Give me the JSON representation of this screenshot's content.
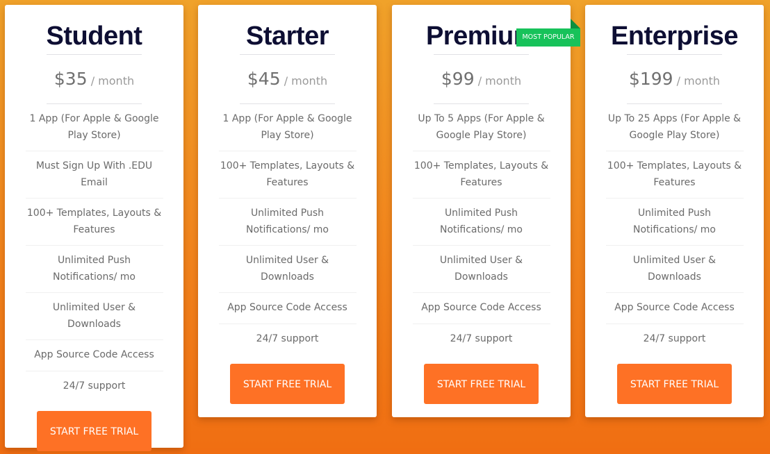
{
  "plans": [
    {
      "name": "Student",
      "price": "$35",
      "period": "/ month",
      "features": [
        "1 App (For Apple & Google Play Store)",
        "Must Sign Up With .EDU Email",
        "100+ Templates, Layouts & Features",
        "Unlimited Push Notifications/ mo",
        "Unlimited User & Downloads",
        "App Source Code Access",
        "24/7 support"
      ],
      "cta": "START FREE TRIAL"
    },
    {
      "name": "Starter",
      "price": "$45",
      "period": "/ month",
      "features": [
        "1 App (For Apple & Google Play Store)",
        "100+ Templates, Layouts & Features",
        "Unlimited Push Notifications/ mo",
        "Unlimited User & Downloads",
        "App Source Code Access",
        "24/7 support"
      ],
      "cta": "START FREE TRIAL"
    },
    {
      "name": "Premium",
      "price": "$99",
      "period": "/ month",
      "badge": "MOST POPULAR",
      "features": [
        "Up To 5 Apps (For Apple & Google Play Store)",
        "100+ Templates, Layouts & Features",
        "Unlimited Push Notifications/ mo",
        "Unlimited User & Downloads",
        "App Source Code Access",
        "24/7 support"
      ],
      "cta": "START FREE TRIAL"
    },
    {
      "name": "Enterprise",
      "price": "$199",
      "period": "/ month",
      "features": [
        "Up To 25 Apps (For Apple & Google Play Store)",
        "100+ Templates, Layouts & Features",
        "Unlimited Push Notifications/ mo",
        "Unlimited User & Downloads",
        "App Source Code Access",
        "24/7 support"
      ],
      "cta": "START FREE TRIAL"
    }
  ],
  "colors": {
    "accent": "#fe7125",
    "badge": "#17c25a",
    "title": "#0d0e33"
  }
}
